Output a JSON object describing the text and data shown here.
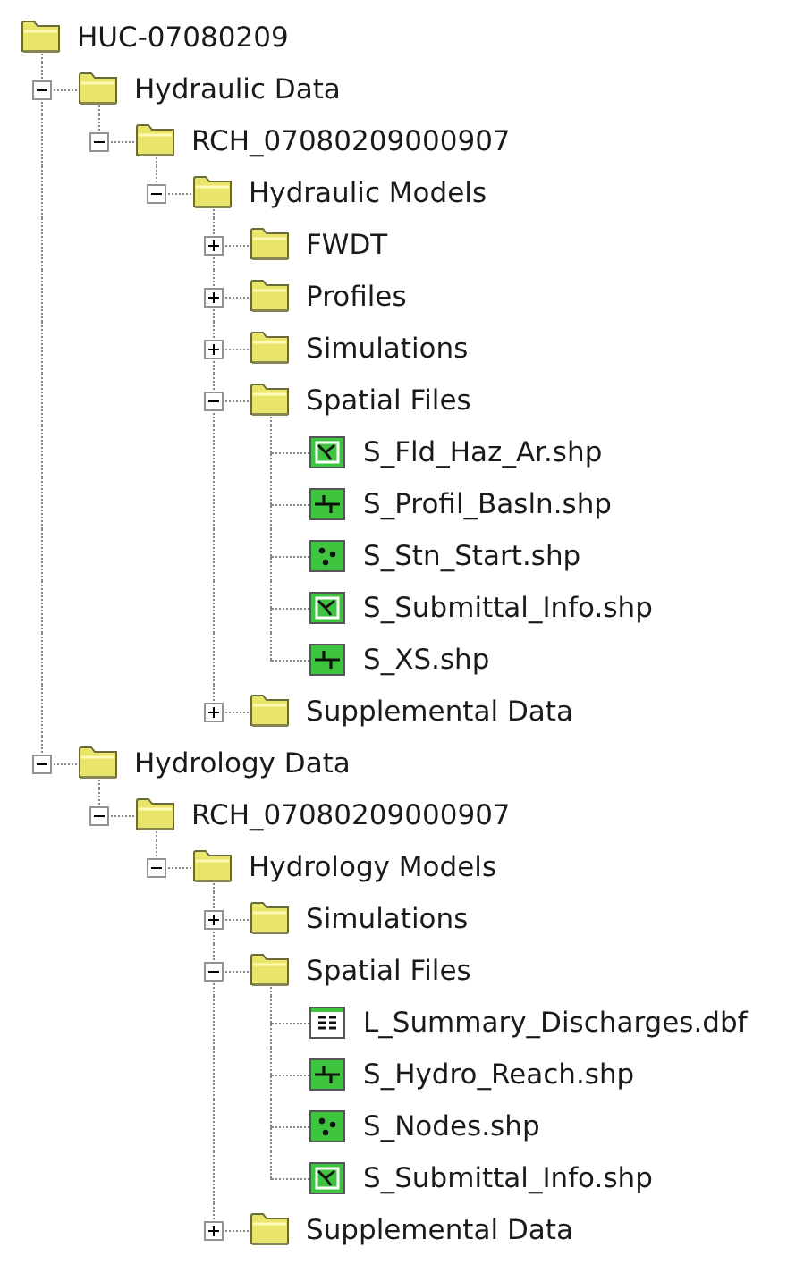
{
  "tree": {
    "label": "HUC-07080209",
    "kind": "folder",
    "children": [
      {
        "label": "Hydraulic Data",
        "kind": "folder",
        "expanded": true,
        "children": [
          {
            "label": "RCH_07080209000907",
            "kind": "folder",
            "expanded": true,
            "children": [
              {
                "label": "Hydraulic Models",
                "kind": "folder",
                "expanded": true,
                "children": [
                  {
                    "label": "FWDT",
                    "kind": "folder",
                    "expanded": false
                  },
                  {
                    "label": "Profiles",
                    "kind": "folder",
                    "expanded": false
                  },
                  {
                    "label": "Simulations",
                    "kind": "folder",
                    "expanded": false
                  },
                  {
                    "label": "Spatial Files",
                    "kind": "folder",
                    "expanded": true,
                    "children": [
                      {
                        "label": "S_Fld_Haz_Ar.shp",
                        "kind": "polygon"
                      },
                      {
                        "label": "S_Profil_Basln.shp",
                        "kind": "line"
                      },
                      {
                        "label": "S_Stn_Start.shp",
                        "kind": "point"
                      },
                      {
                        "label": "S_Submittal_Info.shp",
                        "kind": "polygon"
                      },
                      {
                        "label": "S_XS.shp",
                        "kind": "line"
                      }
                    ]
                  },
                  {
                    "label": "Supplemental Data",
                    "kind": "folder",
                    "expanded": false
                  }
                ]
              }
            ]
          }
        ]
      },
      {
        "label": "Hydrology Data",
        "kind": "folder",
        "expanded": true,
        "children": [
          {
            "label": "RCH_07080209000907",
            "kind": "folder",
            "expanded": true,
            "children": [
              {
                "label": "Hydrology Models",
                "kind": "folder",
                "expanded": true,
                "children": [
                  {
                    "label": "Simulations",
                    "kind": "folder",
                    "expanded": false
                  },
                  {
                    "label": "Spatial Files",
                    "kind": "folder",
                    "expanded": true,
                    "children": [
                      {
                        "label": "L_Summary_Discharges.dbf",
                        "kind": "table"
                      },
                      {
                        "label": "S_Hydro_Reach.shp",
                        "kind": "line"
                      },
                      {
                        "label": "S_Nodes.shp",
                        "kind": "point"
                      },
                      {
                        "label": "S_Submittal_Info.shp",
                        "kind": "polygon"
                      }
                    ]
                  },
                  {
                    "label": "Supplemental Data",
                    "kind": "folder",
                    "expanded": false
                  }
                ]
              }
            ]
          }
        ]
      }
    ]
  }
}
